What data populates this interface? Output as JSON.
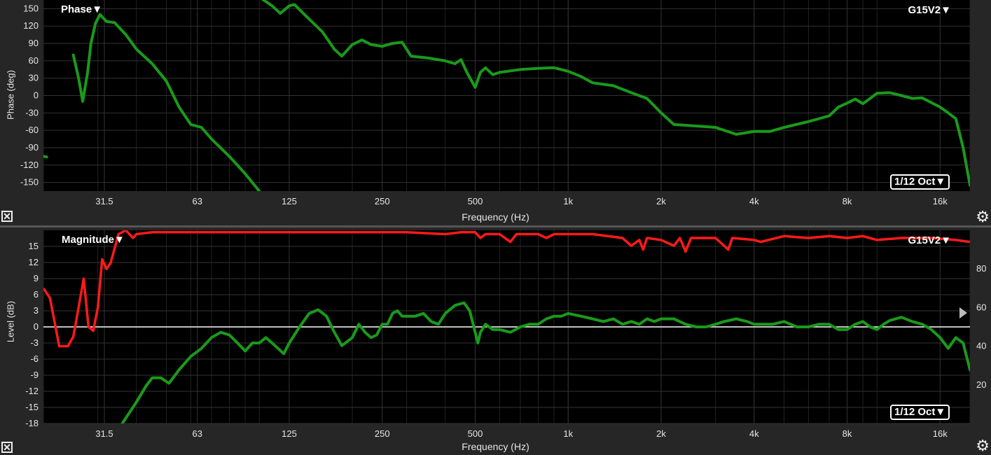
{
  "phase_panel": {
    "title": "Phase▼",
    "measurement": "G15V2▼",
    "smoothing": "1/12 Oct▼",
    "ylabel": "Phase (deg)",
    "xlabel": "Frequency (Hz)"
  },
  "magnitude_panel": {
    "title": "Magnitude▼",
    "measurement": "G15V2▼",
    "smoothing": "1/12 Oct▼",
    "ylabel": "Level (dB)",
    "xlabel": "Frequency (Hz)"
  },
  "icons": {
    "close": "close-icon",
    "settings": "gear-icon"
  },
  "colors": {
    "background": "#000000",
    "grid": "#333333",
    "phase_trace": "#1a9a1a",
    "level_trace": "#1a9a1a",
    "coherence_trace": "#ff1a1a",
    "zero_line": "#ffffff"
  },
  "chart_data": [
    {
      "type": "line",
      "title": "Phase",
      "xlabel": "Frequency (Hz)",
      "ylabel": "Phase (deg)",
      "xscale": "log",
      "xlim": [
        20,
        20000
      ],
      "ylim": [
        -165,
        165
      ],
      "xticks": [
        "31.5",
        "63",
        "125",
        "250",
        "500",
        "1k",
        "2k",
        "4k",
        "8k",
        "16k"
      ],
      "xtick_values": [
        31.5,
        63,
        125,
        250,
        500,
        1000,
        2000,
        4000,
        8000,
        16000
      ],
      "yticks": [
        150,
        120,
        90,
        60,
        30,
        0,
        -30,
        -60,
        -90,
        -120,
        -150
      ],
      "grid": true,
      "series": [
        {
          "name": "G15V2",
          "segments": [
            [
              [
                20,
                -105
              ],
              [
                20.5,
                -106
              ]
            ],
            [
              [
                25,
                70
              ],
              [
                26,
                30
              ],
              [
                26.8,
                -10
              ],
              [
                27.8,
                40
              ],
              [
                28.5,
                90
              ],
              [
                29.5,
                125
              ],
              [
                30.5,
                140
              ],
              [
                32,
                128
              ],
              [
                34,
                126
              ],
              [
                37,
                105
              ],
              [
                40,
                80
              ],
              [
                45,
                55
              ],
              [
                50,
                25
              ],
              [
                55,
                -20
              ],
              [
                60,
                -50
              ],
              [
                65,
                -55
              ],
              [
                70,
                -75
              ],
              [
                80,
                -105
              ],
              [
                90,
                -135
              ],
              [
                100,
                -165
              ]
            ],
            [
              [
                88,
                -170
              ],
              [
                95,
                -167
              ]
            ],
            [
              [
                93,
                175
              ],
              [
                100,
                170
              ],
              [
                110,
                155
              ],
              [
                117,
                142
              ],
              [
                125,
                155
              ],
              [
                130,
                157
              ],
              [
                140,
                140
              ],
              [
                160,
                110
              ],
              [
                175,
                80
              ],
              [
                185,
                68
              ],
              [
                200,
                88
              ],
              [
                215,
                96
              ],
              [
                230,
                88
              ],
              [
                250,
                85
              ],
              [
                270,
                90
              ],
              [
                290,
                92
              ],
              [
                310,
                68
              ],
              [
                350,
                65
              ],
              [
                400,
                60
              ],
              [
                430,
                55
              ],
              [
                450,
                62
              ],
              [
                470,
                40
              ],
              [
                500,
                14
              ],
              [
                520,
                40
              ],
              [
                540,
                48
              ],
              [
                570,
                36
              ],
              [
                600,
                40
              ],
              [
                700,
                45
              ],
              [
                800,
                47
              ],
              [
                900,
                48
              ],
              [
                1000,
                42
              ],
              [
                1100,
                33
              ],
              [
                1200,
                22
              ],
              [
                1400,
                17
              ],
              [
                1600,
                5
              ],
              [
                1800,
                -5
              ],
              [
                2000,
                -30
              ],
              [
                2200,
                -50
              ],
              [
                2500,
                -52
              ],
              [
                3000,
                -55
              ],
              [
                3500,
                -67
              ],
              [
                4000,
                -62
              ],
              [
                4500,
                -62
              ],
              [
                5000,
                -55
              ],
              [
                6000,
                -45
              ],
              [
                7000,
                -35
              ],
              [
                7500,
                -20
              ],
              [
                8000,
                -13
              ],
              [
                8500,
                -6
              ],
              [
                9000,
                -14
              ],
              [
                9500,
                -5
              ],
              [
                10000,
                4
              ],
              [
                11000,
                5
              ],
              [
                12000,
                0
              ],
              [
                13000,
                -5
              ],
              [
                14000,
                -4
              ],
              [
                16000,
                -20
              ],
              [
                17000,
                -30
              ],
              [
                18000,
                -40
              ],
              [
                19000,
                -90
              ],
              [
                20000,
                -155
              ]
            ]
          ]
        }
      ]
    },
    {
      "type": "line",
      "title": "Magnitude",
      "xlabel": "Frequency (Hz)",
      "ylabel": "Level (dB)",
      "xscale": "log",
      "xlim": [
        20,
        20000
      ],
      "ylim": [
        -18,
        18
      ],
      "y2lim": [
        0,
        100
      ],
      "xticks": [
        "31.5",
        "63",
        "125",
        "250",
        "500",
        "1k",
        "2k",
        "4k",
        "8k",
        "16k"
      ],
      "xtick_values": [
        31.5,
        63,
        125,
        250,
        500,
        1000,
        2000,
        4000,
        8000,
        16000
      ],
      "yticks": [
        15,
        12,
        9,
        6,
        3,
        0,
        -3,
        -6,
        -9,
        -12,
        -15,
        -18
      ],
      "y2ticks": [
        80,
        60,
        40,
        20
      ],
      "grid": true,
      "series": [
        {
          "name": "G15V2",
          "axis": "left",
          "points": [
            [
              36,
              -18
            ],
            [
              40,
              -14
            ],
            [
              43,
              -11
            ],
            [
              45,
              -9.5
            ],
            [
              48,
              -9.5
            ],
            [
              51,
              -10.5
            ],
            [
              55,
              -8
            ],
            [
              60,
              -5.5
            ],
            [
              65,
              -4
            ],
            [
              70,
              -2
            ],
            [
              75,
              -1
            ],
            [
              80,
              -1.5
            ],
            [
              85,
              -3
            ],
            [
              90,
              -4.5
            ],
            [
              95,
              -3
            ],
            [
              100,
              -3
            ],
            [
              105,
              -2
            ],
            [
              110,
              -3
            ],
            [
              115,
              -4
            ],
            [
              120,
              -5
            ],
            [
              125,
              -3
            ],
            [
              135,
              0
            ],
            [
              145,
              2.5
            ],
            [
              155,
              3.2
            ],
            [
              165,
              2
            ],
            [
              175,
              -1
            ],
            [
              185,
              -3.5
            ],
            [
              200,
              -2
            ],
            [
              210,
              0.5
            ],
            [
              220,
              -1
            ],
            [
              230,
              -2
            ],
            [
              240,
              -1.5
            ],
            [
              250,
              0.5
            ],
            [
              260,
              0.5
            ],
            [
              270,
              2.5
            ],
            [
              280,
              3
            ],
            [
              290,
              2
            ],
            [
              300,
              2
            ],
            [
              320,
              2
            ],
            [
              340,
              2.5
            ],
            [
              360,
              1
            ],
            [
              380,
              0.5
            ],
            [
              400,
              2.5
            ],
            [
              430,
              4
            ],
            [
              460,
              4.5
            ],
            [
              480,
              3
            ],
            [
              500,
              -1
            ],
            [
              510,
              -3
            ],
            [
              520,
              -1
            ],
            [
              540,
              0.5
            ],
            [
              570,
              -0.5
            ],
            [
              600,
              -0.5
            ],
            [
              650,
              -1
            ],
            [
              700,
              0
            ],
            [
              750,
              0.5
            ],
            [
              800,
              0.5
            ],
            [
              850,
              1.5
            ],
            [
              900,
              2
            ],
            [
              950,
              2
            ],
            [
              1000,
              2.5
            ],
            [
              1100,
              2
            ],
            [
              1200,
              1.5
            ],
            [
              1300,
              1
            ],
            [
              1400,
              1.5
            ],
            [
              1500,
              0.5
            ],
            [
              1600,
              1
            ],
            [
              1700,
              0.5
            ],
            [
              1800,
              1.5
            ],
            [
              1900,
              1
            ],
            [
              2000,
              1.5
            ],
            [
              2200,
              1.5
            ],
            [
              2400,
              0.5
            ],
            [
              2600,
              0
            ],
            [
              2800,
              0
            ],
            [
              3000,
              0.5
            ],
            [
              3200,
              1
            ],
            [
              3500,
              1.5
            ],
            [
              3800,
              1
            ],
            [
              4000,
              0.5
            ],
            [
              4300,
              0.5
            ],
            [
              4600,
              0.5
            ],
            [
              5000,
              1
            ],
            [
              5500,
              0
            ],
            [
              6000,
              0
            ],
            [
              6500,
              0.5
            ],
            [
              7000,
              0.5
            ],
            [
              7500,
              -0.5
            ],
            [
              8000,
              -0.5
            ],
            [
              8500,
              0.5
            ],
            [
              9000,
              1
            ],
            [
              9500,
              0
            ],
            [
              10000,
              -0.5
            ],
            [
              10500,
              0.5
            ],
            [
              11000,
              1.2
            ],
            [
              12000,
              1.8
            ],
            [
              13000,
              1
            ],
            [
              14000,
              0.5
            ],
            [
              15000,
              -0.5
            ],
            [
              16000,
              -2
            ],
            [
              17000,
              -4
            ],
            [
              18000,
              -2
            ],
            [
              19000,
              -3
            ],
            [
              20000,
              -8
            ]
          ]
        },
        {
          "name": "Coherence",
          "axis": "right",
          "points": [
            [
              20,
              70
            ],
            [
              21,
              65
            ],
            [
              22.5,
              40
            ],
            [
              24,
              40
            ],
            [
              25,
              45
            ],
            [
              26,
              60
            ],
            [
              27,
              75
            ],
            [
              28,
              50
            ],
            [
              29,
              48
            ],
            [
              30,
              60
            ],
            [
              31,
              85
            ],
            [
              32,
              80
            ],
            [
              33,
              83
            ],
            [
              35,
              98
            ],
            [
              37,
              100
            ],
            [
              38,
              98
            ],
            [
              39,
              96
            ],
            [
              40,
              98
            ],
            [
              45,
              99
            ],
            [
              60,
              99
            ],
            [
              100,
              99
            ],
            [
              200,
              99
            ],
            [
              300,
              99
            ],
            [
              400,
              98
            ],
            [
              450,
              99
            ],
            [
              500,
              99
            ],
            [
              520,
              96
            ],
            [
              540,
              98
            ],
            [
              600,
              98
            ],
            [
              650,
              94
            ],
            [
              680,
              98
            ],
            [
              800,
              98
            ],
            [
              850,
              96
            ],
            [
              900,
              98
            ],
            [
              1200,
              98
            ],
            [
              1500,
              96
            ],
            [
              1600,
              92
            ],
            [
              1700,
              95
            ],
            [
              1750,
              90
            ],
            [
              1800,
              96
            ],
            [
              2000,
              95
            ],
            [
              2200,
              92
            ],
            [
              2300,
              96
            ],
            [
              2400,
              89
            ],
            [
              2500,
              96
            ],
            [
              3000,
              96
            ],
            [
              3300,
              90
            ],
            [
              3400,
              96
            ],
            [
              4000,
              95
            ],
            [
              4200,
              94
            ],
            [
              5000,
              97
            ],
            [
              6000,
              96
            ],
            [
              7000,
              97
            ],
            [
              8000,
              96
            ],
            [
              9000,
              97
            ],
            [
              10000,
              95
            ],
            [
              12000,
              96
            ],
            [
              15000,
              96
            ],
            [
              18000,
              95
            ],
            [
              20000,
              94
            ]
          ]
        }
      ]
    }
  ]
}
